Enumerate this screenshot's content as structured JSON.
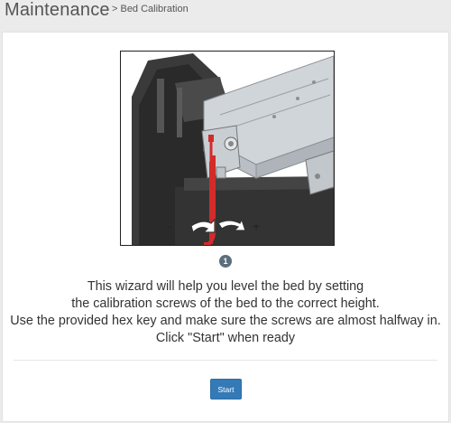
{
  "header": {
    "title": "Maintenance",
    "breadcrumb": "> Bed Calibration"
  },
  "figure": {
    "minus_sign": "-",
    "plus_sign": "+"
  },
  "step_indicator": "1",
  "instructions": {
    "line1": "This wizard will help you level the bed by setting",
    "line2": "the calibration screws of the bed to the correct height.",
    "line3": "Use the provided hex key and make sure the screws are almost halfway in.",
    "line4": "Click \"Start\" when ready"
  },
  "start_button": "Start",
  "colors": {
    "accent": "#337ab7",
    "hex_key": "#d42a2a",
    "step_badge": "#5d6e7d"
  }
}
